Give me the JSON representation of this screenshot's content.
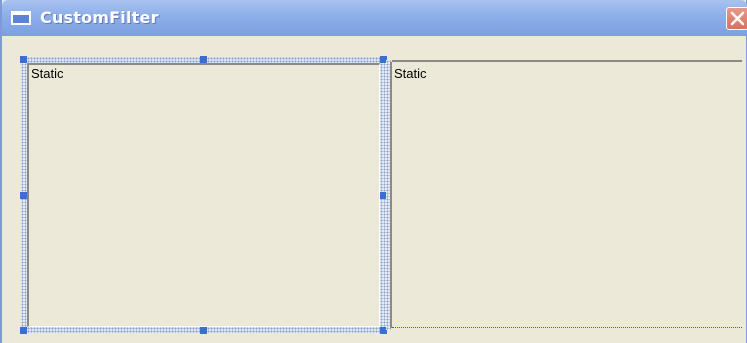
{
  "window": {
    "title": "CustomFilter",
    "icon": "window-icon",
    "close_icon": "close-icon"
  },
  "controls": {
    "left_static": {
      "label": "Static",
      "selected": true
    },
    "right_static": {
      "label": "Static",
      "selected": false
    }
  },
  "colors": {
    "titlebar": "#8fb0ea",
    "client_bg": "#ece9d8",
    "selection_handle": "#3a6fd0",
    "close_button": "#d9705c"
  }
}
